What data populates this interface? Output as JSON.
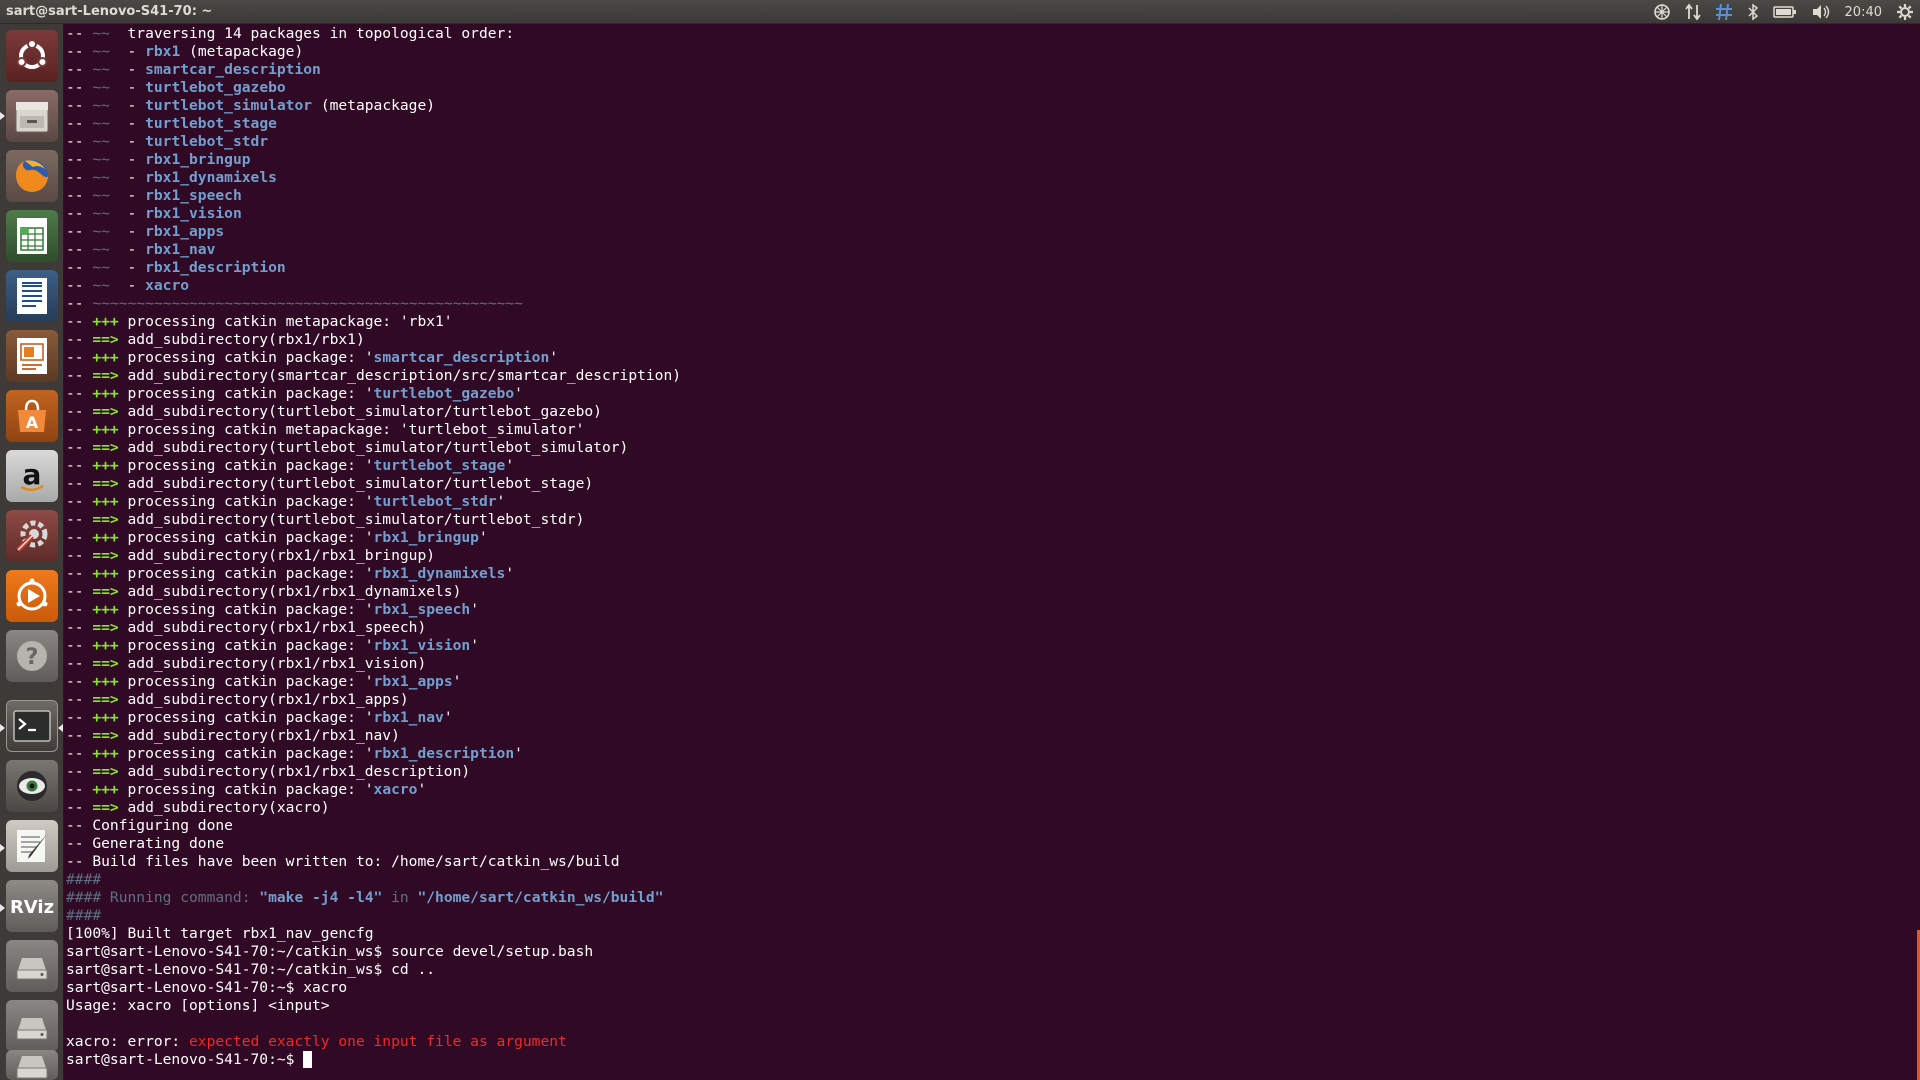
{
  "panel": {
    "window_title": "sart@sart-Lenovo-S41-70: ~",
    "clock": "20:40"
  },
  "launcher": {
    "items": [
      {
        "name": "ubuntu-dash",
        "icon": "ubuntu-logo-icon"
      },
      {
        "name": "files",
        "icon": "file-cabinet-icon"
      },
      {
        "name": "firefox",
        "icon": "firefox-icon"
      },
      {
        "name": "libreoffice-calc",
        "icon": "spreadsheet-icon"
      },
      {
        "name": "libreoffice-writer",
        "icon": "document-icon"
      },
      {
        "name": "libreoffice-impress",
        "icon": "presentation-icon"
      },
      {
        "name": "ubuntu-software",
        "icon": "software-bag-icon"
      },
      {
        "name": "amazon",
        "icon": "amazon-icon"
      },
      {
        "name": "system-settings",
        "icon": "settings-tools-icon"
      },
      {
        "name": "rhythmbox",
        "icon": "media-player-icon"
      },
      {
        "name": "help",
        "icon": "help-icon"
      },
      {
        "name": "terminal",
        "icon": "terminal-icon"
      },
      {
        "name": "eye-app",
        "icon": "eye-icon"
      },
      {
        "name": "text-editor",
        "icon": "text-editor-icon"
      },
      {
        "name": "rviz",
        "icon": "rviz-icon",
        "label": "RViz"
      },
      {
        "name": "drive-1",
        "icon": "hard-drive-icon"
      },
      {
        "name": "drive-2",
        "icon": "hard-drive-icon"
      },
      {
        "name": "trash",
        "icon": "trash-icon"
      }
    ]
  },
  "terminal": {
    "lines": [
      [
        {
          "t": "-- ",
          "c": ""
        },
        {
          "t": "~~",
          "c": "dim"
        },
        {
          "t": "  traversing 14 packages in topological order:",
          "c": ""
        }
      ],
      [
        {
          "t": "-- ",
          "c": ""
        },
        {
          "t": "~~",
          "c": "dim"
        },
        {
          "t": "  - ",
          "c": ""
        },
        {
          "t": "rbx1",
          "c": "blue"
        },
        {
          "t": " (metapackage)",
          "c": ""
        }
      ],
      [
        {
          "t": "-- ",
          "c": ""
        },
        {
          "t": "~~",
          "c": "dim"
        },
        {
          "t": "  - ",
          "c": ""
        },
        {
          "t": "smartcar_description",
          "c": "blue"
        }
      ],
      [
        {
          "t": "-- ",
          "c": ""
        },
        {
          "t": "~~",
          "c": "dim"
        },
        {
          "t": "  - ",
          "c": ""
        },
        {
          "t": "turtlebot_gazebo",
          "c": "blue"
        }
      ],
      [
        {
          "t": "-- ",
          "c": ""
        },
        {
          "t": "~~",
          "c": "dim"
        },
        {
          "t": "  - ",
          "c": ""
        },
        {
          "t": "turtlebot_simulator",
          "c": "blue"
        },
        {
          "t": " (metapackage)",
          "c": ""
        }
      ],
      [
        {
          "t": "-- ",
          "c": ""
        },
        {
          "t": "~~",
          "c": "dim"
        },
        {
          "t": "  - ",
          "c": ""
        },
        {
          "t": "turtlebot_stage",
          "c": "blue"
        }
      ],
      [
        {
          "t": "-- ",
          "c": ""
        },
        {
          "t": "~~",
          "c": "dim"
        },
        {
          "t": "  - ",
          "c": ""
        },
        {
          "t": "turtlebot_stdr",
          "c": "blue"
        }
      ],
      [
        {
          "t": "-- ",
          "c": ""
        },
        {
          "t": "~~",
          "c": "dim"
        },
        {
          "t": "  - ",
          "c": ""
        },
        {
          "t": "rbx1_bringup",
          "c": "blue"
        }
      ],
      [
        {
          "t": "-- ",
          "c": ""
        },
        {
          "t": "~~",
          "c": "dim"
        },
        {
          "t": "  - ",
          "c": ""
        },
        {
          "t": "rbx1_dynamixels",
          "c": "blue"
        }
      ],
      [
        {
          "t": "-- ",
          "c": ""
        },
        {
          "t": "~~",
          "c": "dim"
        },
        {
          "t": "  - ",
          "c": ""
        },
        {
          "t": "rbx1_speech",
          "c": "blue"
        }
      ],
      [
        {
          "t": "-- ",
          "c": ""
        },
        {
          "t": "~~",
          "c": "dim"
        },
        {
          "t": "  - ",
          "c": ""
        },
        {
          "t": "rbx1_vision",
          "c": "blue"
        }
      ],
      [
        {
          "t": "-- ",
          "c": ""
        },
        {
          "t": "~~",
          "c": "dim"
        },
        {
          "t": "  - ",
          "c": ""
        },
        {
          "t": "rbx1_apps",
          "c": "blue"
        }
      ],
      [
        {
          "t": "-- ",
          "c": ""
        },
        {
          "t": "~~",
          "c": "dim"
        },
        {
          "t": "  - ",
          "c": ""
        },
        {
          "t": "rbx1_nav",
          "c": "blue"
        }
      ],
      [
        {
          "t": "-- ",
          "c": ""
        },
        {
          "t": "~~",
          "c": "dim"
        },
        {
          "t": "  - ",
          "c": ""
        },
        {
          "t": "rbx1_description",
          "c": "blue"
        }
      ],
      [
        {
          "t": "-- ",
          "c": ""
        },
        {
          "t": "~~",
          "c": "dim"
        },
        {
          "t": "  - ",
          "c": ""
        },
        {
          "t": "xacro",
          "c": "blue"
        }
      ],
      [
        {
          "t": "-- ",
          "c": ""
        },
        {
          "t": "~~~~~~~~~~~~~~~~~~~~~~~~~~~~~~~~~~~~~~~~~~~~~~~~~",
          "c": "dim"
        }
      ],
      [
        {
          "t": "-- ",
          "c": ""
        },
        {
          "t": "+++",
          "c": "green"
        },
        {
          "t": " processing catkin metapackage: 'rbx1'",
          "c": ""
        }
      ],
      [
        {
          "t": "-- ",
          "c": ""
        },
        {
          "t": "==>",
          "c": "green"
        },
        {
          "t": " add_subdirectory(rbx1/rbx1)",
          "c": ""
        }
      ],
      [
        {
          "t": "-- ",
          "c": ""
        },
        {
          "t": "+++",
          "c": "green"
        },
        {
          "t": " processing catkin package: '",
          "c": ""
        },
        {
          "t": "smartcar_description",
          "c": "blue"
        },
        {
          "t": "'",
          "c": ""
        }
      ],
      [
        {
          "t": "-- ",
          "c": ""
        },
        {
          "t": "==>",
          "c": "green"
        },
        {
          "t": " add_subdirectory(smartcar_description/src/smartcar_description)",
          "c": ""
        }
      ],
      [
        {
          "t": "-- ",
          "c": ""
        },
        {
          "t": "+++",
          "c": "green"
        },
        {
          "t": " processing catkin package: '",
          "c": ""
        },
        {
          "t": "turtlebot_gazebo",
          "c": "blue"
        },
        {
          "t": "'",
          "c": ""
        }
      ],
      [
        {
          "t": "-- ",
          "c": ""
        },
        {
          "t": "==>",
          "c": "green"
        },
        {
          "t": " add_subdirectory(turtlebot_simulator/turtlebot_gazebo)",
          "c": ""
        }
      ],
      [
        {
          "t": "-- ",
          "c": ""
        },
        {
          "t": "+++",
          "c": "green"
        },
        {
          "t": " processing catkin metapackage: 'turtlebot_simulator'",
          "c": ""
        }
      ],
      [
        {
          "t": "-- ",
          "c": ""
        },
        {
          "t": "==>",
          "c": "green"
        },
        {
          "t": " add_subdirectory(turtlebot_simulator/turtlebot_simulator)",
          "c": ""
        }
      ],
      [
        {
          "t": "-- ",
          "c": ""
        },
        {
          "t": "+++",
          "c": "green"
        },
        {
          "t": " processing catkin package: '",
          "c": ""
        },
        {
          "t": "turtlebot_stage",
          "c": "blue"
        },
        {
          "t": "'",
          "c": ""
        }
      ],
      [
        {
          "t": "-- ",
          "c": ""
        },
        {
          "t": "==>",
          "c": "green"
        },
        {
          "t": " add_subdirectory(turtlebot_simulator/turtlebot_stage)",
          "c": ""
        }
      ],
      [
        {
          "t": "-- ",
          "c": ""
        },
        {
          "t": "+++",
          "c": "green"
        },
        {
          "t": " processing catkin package: '",
          "c": ""
        },
        {
          "t": "turtlebot_stdr",
          "c": "blue"
        },
        {
          "t": "'",
          "c": ""
        }
      ],
      [
        {
          "t": "-- ",
          "c": ""
        },
        {
          "t": "==>",
          "c": "green"
        },
        {
          "t": " add_subdirectory(turtlebot_simulator/turtlebot_stdr)",
          "c": ""
        }
      ],
      [
        {
          "t": "-- ",
          "c": ""
        },
        {
          "t": "+++",
          "c": "green"
        },
        {
          "t": " processing catkin package: '",
          "c": ""
        },
        {
          "t": "rbx1_bringup",
          "c": "blue"
        },
        {
          "t": "'",
          "c": ""
        }
      ],
      [
        {
          "t": "-- ",
          "c": ""
        },
        {
          "t": "==>",
          "c": "green"
        },
        {
          "t": " add_subdirectory(rbx1/rbx1_bringup)",
          "c": ""
        }
      ],
      [
        {
          "t": "-- ",
          "c": ""
        },
        {
          "t": "+++",
          "c": "green"
        },
        {
          "t": " processing catkin package: '",
          "c": ""
        },
        {
          "t": "rbx1_dynamixels",
          "c": "blue"
        },
        {
          "t": "'",
          "c": ""
        }
      ],
      [
        {
          "t": "-- ",
          "c": ""
        },
        {
          "t": "==>",
          "c": "green"
        },
        {
          "t": " add_subdirectory(rbx1/rbx1_dynamixels)",
          "c": ""
        }
      ],
      [
        {
          "t": "-- ",
          "c": ""
        },
        {
          "t": "+++",
          "c": "green"
        },
        {
          "t": " processing catkin package: '",
          "c": ""
        },
        {
          "t": "rbx1_speech",
          "c": "blue"
        },
        {
          "t": "'",
          "c": ""
        }
      ],
      [
        {
          "t": "-- ",
          "c": ""
        },
        {
          "t": "==>",
          "c": "green"
        },
        {
          "t": " add_subdirectory(rbx1/rbx1_speech)",
          "c": ""
        }
      ],
      [
        {
          "t": "-- ",
          "c": ""
        },
        {
          "t": "+++",
          "c": "green"
        },
        {
          "t": " processing catkin package: '",
          "c": ""
        },
        {
          "t": "rbx1_vision",
          "c": "blue"
        },
        {
          "t": "'",
          "c": ""
        }
      ],
      [
        {
          "t": "-- ",
          "c": ""
        },
        {
          "t": "==>",
          "c": "green"
        },
        {
          "t": " add_subdirectory(rbx1/rbx1_vision)",
          "c": ""
        }
      ],
      [
        {
          "t": "-- ",
          "c": ""
        },
        {
          "t": "+++",
          "c": "green"
        },
        {
          "t": " processing catkin package: '",
          "c": ""
        },
        {
          "t": "rbx1_apps",
          "c": "blue"
        },
        {
          "t": "'",
          "c": ""
        }
      ],
      [
        {
          "t": "-- ",
          "c": ""
        },
        {
          "t": "==>",
          "c": "green"
        },
        {
          "t": " add_subdirectory(rbx1/rbx1_apps)",
          "c": ""
        }
      ],
      [
        {
          "t": "-- ",
          "c": ""
        },
        {
          "t": "+++",
          "c": "green"
        },
        {
          "t": " processing catkin package: '",
          "c": ""
        },
        {
          "t": "rbx1_nav",
          "c": "blue"
        },
        {
          "t": "'",
          "c": ""
        }
      ],
      [
        {
          "t": "-- ",
          "c": ""
        },
        {
          "t": "==>",
          "c": "green"
        },
        {
          "t": " add_subdirectory(rbx1/rbx1_nav)",
          "c": ""
        }
      ],
      [
        {
          "t": "-- ",
          "c": ""
        },
        {
          "t": "+++",
          "c": "green"
        },
        {
          "t": " processing catkin package: '",
          "c": ""
        },
        {
          "t": "rbx1_description",
          "c": "blue"
        },
        {
          "t": "'",
          "c": ""
        }
      ],
      [
        {
          "t": "-- ",
          "c": ""
        },
        {
          "t": "==>",
          "c": "green"
        },
        {
          "t": " add_subdirectory(rbx1/rbx1_description)",
          "c": ""
        }
      ],
      [
        {
          "t": "-- ",
          "c": ""
        },
        {
          "t": "+++",
          "c": "green"
        },
        {
          "t": " processing catkin package: '",
          "c": ""
        },
        {
          "t": "xacro",
          "c": "blue"
        },
        {
          "t": "'",
          "c": ""
        }
      ],
      [
        {
          "t": "-- ",
          "c": ""
        },
        {
          "t": "==>",
          "c": "green"
        },
        {
          "t": " add_subdirectory(xacro)",
          "c": ""
        }
      ],
      [
        {
          "t": "-- Configuring done",
          "c": ""
        }
      ],
      [
        {
          "t": "-- Generating done",
          "c": ""
        }
      ],
      [
        {
          "t": "-- Build files have been written to: /home/sart/catkin_ws/build",
          "c": ""
        }
      ],
      [
        {
          "t": "####",
          "c": "dim"
        }
      ],
      [
        {
          "t": "#### Running command: ",
          "c": "dim"
        },
        {
          "t": "\"make -j4 -l4\"",
          "c": "blue"
        },
        {
          "t": " in ",
          "c": "dim"
        },
        {
          "t": "\"/home/sart/catkin_ws/build\"",
          "c": "blue"
        }
      ],
      [
        {
          "t": "####",
          "c": "dim"
        }
      ],
      [
        {
          "t": "[100%] Built target rbx1_nav_gencfg",
          "c": ""
        }
      ],
      [
        {
          "t": "sart@sart-Lenovo-S41-70:~/catkin_ws$ source devel/setup.bash",
          "c": ""
        }
      ],
      [
        {
          "t": "sart@sart-Lenovo-S41-70:~/catkin_ws$ cd ..",
          "c": ""
        }
      ],
      [
        {
          "t": "sart@sart-Lenovo-S41-70:~$ xacro",
          "c": ""
        }
      ],
      [
        {
          "t": "Usage: xacro [options] <input>",
          "c": ""
        }
      ],
      [
        {
          "t": "",
          "c": ""
        }
      ],
      [
        {
          "t": "xacro: error: ",
          "c": ""
        },
        {
          "t": "expected exactly one input file as argument",
          "c": "red"
        }
      ],
      [
        {
          "t": "sart@sart-Lenovo-S41-70:~$ ",
          "c": ""
        }
      ]
    ]
  },
  "colors": {
    "terminal_bg": "#300a24",
    "launcher_bg": "#3d3a37",
    "package_blue": "#729fcf",
    "marker_green": "#8ae234",
    "error_red": "#ef2929",
    "dim_text": "#5e6e83"
  }
}
